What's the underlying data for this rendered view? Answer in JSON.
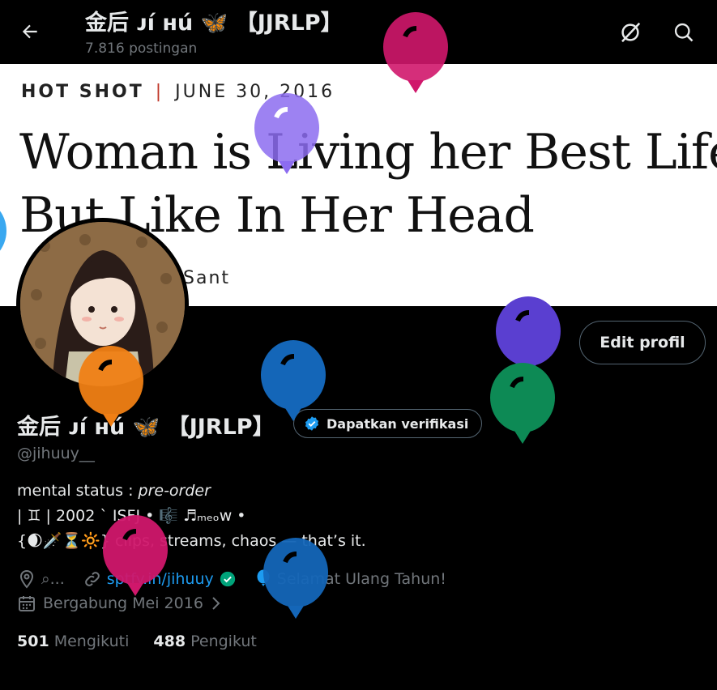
{
  "header": {
    "title": "金后 ᴊí ʜú 🦋 【JJRLP】",
    "post_count": "7.816 postingan"
  },
  "banner": {
    "kicker": "HOT SHOT",
    "date": "JUNE 30, 2016",
    "headline_line1": "Woman is Living her Best Life.",
    "headline_line2": "But Like In Her Head",
    "byline": "Sant"
  },
  "profile": {
    "edit_label": "Edit profil",
    "display_name": "金后 ᴊí ʜú 🦋 【JJRLP】",
    "verify_label": "Dapatkan verifikasi",
    "handle": "@jihuuy__",
    "bio_line1_prefix": "mental status : ",
    "bio_line1_italic": "pre-order",
    "bio_line2": "| ♊ | 2002 ˋ ISFJ • 🎼 ♬ₘₑₒw •",
    "bio_line3": "{🌒🗡️⏳🔆} clips, streams, chaos — that’s it.",
    "location": "⌕...",
    "link": "sptfy.in/jihuuy",
    "birthday": "Selamat Ulang Tahun!",
    "joined": "Bergabung Mei 2016"
  },
  "stats": {
    "following_count": "501",
    "following_label": "Mengikuti",
    "followers_count": "488",
    "followers_label": "Pengikut"
  },
  "colors": {
    "accent": "#1d9bf0",
    "balloon_colors": [
      "#d0176b",
      "#8c6cf0",
      "#f07f14",
      "#1466b8",
      "#5a3fd0",
      "#0d8a55",
      "#d0176b",
      "#1466b8",
      "#3aa8f0"
    ]
  },
  "icons": [
    "back-arrow-icon",
    "grok-icon",
    "search-icon",
    "verified-badge-icon",
    "location-icon",
    "link-icon",
    "balloon-icon",
    "calendar-icon",
    "chevron-right-icon"
  ]
}
